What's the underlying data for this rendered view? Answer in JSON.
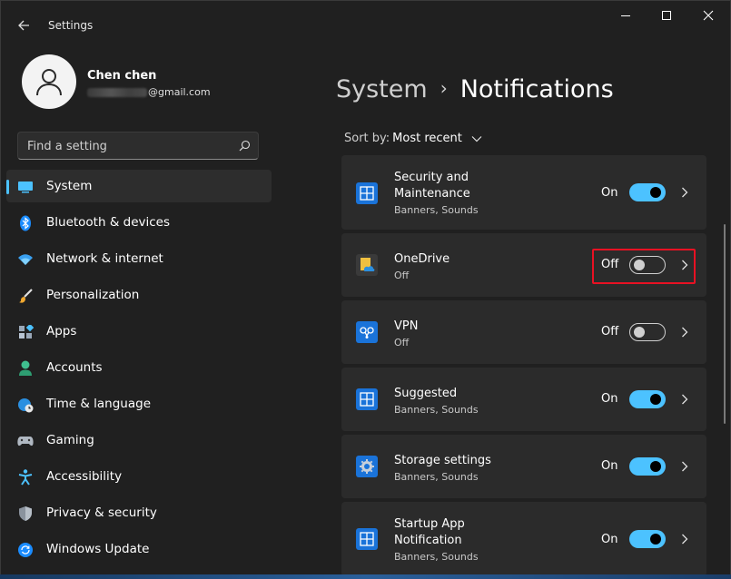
{
  "app": {
    "title": "Settings"
  },
  "profile": {
    "name": "Chen chen",
    "email_suffix": "@gmail.com"
  },
  "search": {
    "placeholder": "Find a setting"
  },
  "nav": {
    "items": [
      {
        "label": "System",
        "icon": "system-icon",
        "active": true
      },
      {
        "label": "Bluetooth & devices",
        "icon": "bluetooth-icon"
      },
      {
        "label": "Network & internet",
        "icon": "wifi-icon"
      },
      {
        "label": "Personalization",
        "icon": "brush-icon"
      },
      {
        "label": "Apps",
        "icon": "apps-icon"
      },
      {
        "label": "Accounts",
        "icon": "person-icon"
      },
      {
        "label": "Time & language",
        "icon": "globe-clock-icon"
      },
      {
        "label": "Gaming",
        "icon": "gamepad-icon"
      },
      {
        "label": "Accessibility",
        "icon": "accessibility-icon"
      },
      {
        "label": "Privacy & security",
        "icon": "shield-icon"
      },
      {
        "label": "Windows Update",
        "icon": "update-icon"
      }
    ]
  },
  "breadcrumb": {
    "parent": "System",
    "separator": "›",
    "current": "Notifications"
  },
  "sort": {
    "label": "Sort by:",
    "value": "Most recent"
  },
  "notifications": [
    {
      "title": "Security and Maintenance",
      "subtitle": "Banners, Sounds",
      "state": "On",
      "enabled": true,
      "icon": "security-maintenance-icon"
    },
    {
      "title": "OneDrive",
      "subtitle": "Off",
      "state": "Off",
      "enabled": false,
      "icon": "onedrive-icon"
    },
    {
      "title": "VPN",
      "subtitle": "Off",
      "state": "Off",
      "enabled": false,
      "icon": "vpn-icon"
    },
    {
      "title": "Suggested",
      "subtitle": "Banners, Sounds",
      "state": "On",
      "enabled": true,
      "icon": "suggested-icon"
    },
    {
      "title": "Storage settings",
      "subtitle": "Banners, Sounds",
      "state": "On",
      "enabled": true,
      "icon": "storage-gear-icon"
    },
    {
      "title": "Startup App Notification",
      "subtitle": "Banners, Sounds",
      "state": "On",
      "enabled": true,
      "icon": "startup-app-icon"
    }
  ],
  "colors": {
    "accent": "#4cc2ff",
    "highlight": "#e81123",
    "background": "#202020",
    "card": "#2b2b2b"
  }
}
